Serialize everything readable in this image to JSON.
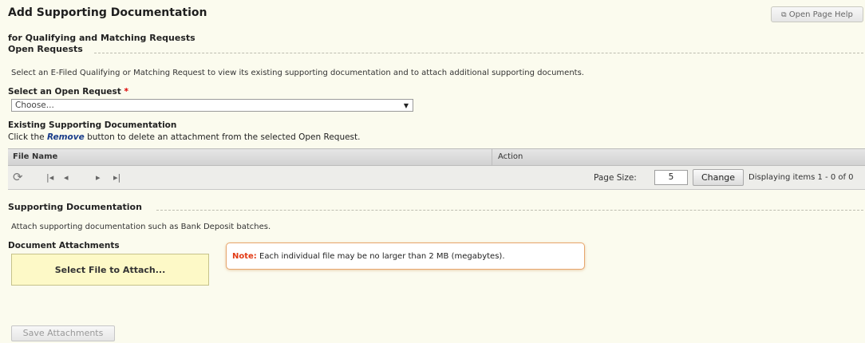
{
  "page": {
    "title": "Add Supporting Documentation",
    "subtitle": "for Qualifying and Matching Requests",
    "help_button": "Open Page Help",
    "help_icon": "popup-window-icon"
  },
  "open_requests": {
    "heading": "Open Requests",
    "intro": "Select an E-Filed Qualifying or Matching Request to view its existing supporting documentation and to attach additional supporting documents.",
    "select_label": "Select an Open Request",
    "required_marker": "*",
    "select_value": "Choose..."
  },
  "existing_docs": {
    "heading": "Existing Supporting Documentation",
    "instruction_prefix": "Click the",
    "instruction_keyword": "Remove",
    "instruction_suffix": "button to delete an attachment from the selected Open Request.",
    "columns": [
      "File Name",
      "Action"
    ],
    "rows": [],
    "pager": {
      "page_size_label": "Page Size:",
      "page_size": "5",
      "change_label": "Change",
      "display_text": "Displaying items 1 - 0 of 0",
      "icons": [
        "refresh-icon",
        "first-page-icon",
        "prev-page-icon",
        "next-page-icon",
        "last-page-icon"
      ]
    }
  },
  "supporting": {
    "heading": "Supporting Documentation",
    "intro": "Attach supporting documentation such as Bank Deposit batches.",
    "attachments_label": "Document Attachments",
    "select_file_button": "Select File to Attach...",
    "note_label": "Note:",
    "note_text": "Each individual file may be no larger than 2 MB (megabytes)."
  },
  "save_button": "Save Attachments",
  "colors": {
    "background": "#fbfbee",
    "required": "#dd0000",
    "note_label": "#e23b16",
    "note_border": "#e7a66d",
    "attach_box": "#fdf9c7"
  }
}
